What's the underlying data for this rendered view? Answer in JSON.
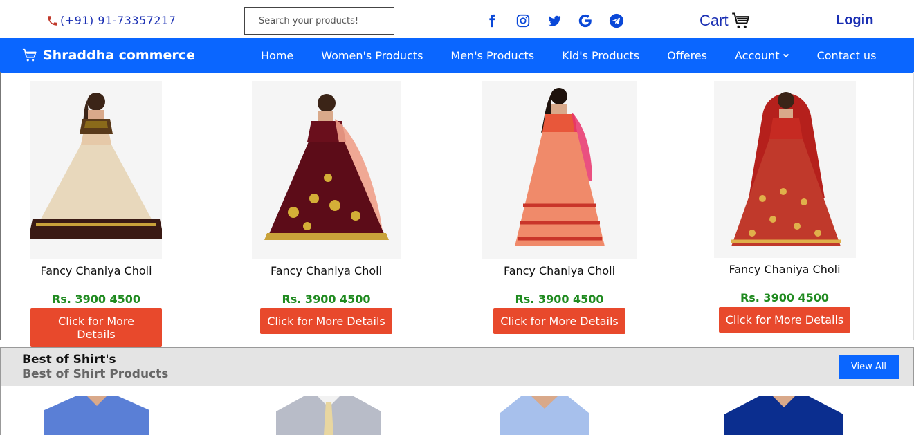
{
  "topbar": {
    "phone": "(+91) 91-73357217",
    "search_placeholder": "Search your products!",
    "social": [
      "facebook-icon",
      "instagram-icon",
      "twitter-icon",
      "google-icon",
      "telegram-icon"
    ],
    "cart_label": "Cart",
    "login_label": "Login"
  },
  "nav": {
    "brand": "Shraddha commerce",
    "items": [
      "Home",
      "Women's Products",
      "Men's Products",
      "Kid's Products",
      "Offeres",
      "Account",
      "Contact us"
    ]
  },
  "products": [
    {
      "title": "Fancy Chaniya Choli",
      "price": "Rs. 3900 4500",
      "button": "Click for More Details"
    },
    {
      "title": "Fancy Chaniya Choli",
      "price": "Rs. 3900 4500",
      "button": "Click for More Details"
    },
    {
      "title": "Fancy Chaniya Choli",
      "price": "Rs. 3900 4500",
      "button": "Click for More Details"
    },
    {
      "title": "Fancy Chaniya Choli",
      "price": "Rs. 3900 4500",
      "button": "Click for More Details"
    }
  ],
  "shirts": {
    "heading": "Best of Shirt's",
    "subheading": "Best of Shirt Products",
    "view_all": "View All"
  },
  "colors": {
    "nav_bg": "#0a66ff",
    "link_blue": "#1a2fb3",
    "price_green": "#1f8a1f",
    "button_red": "#e8492c"
  }
}
